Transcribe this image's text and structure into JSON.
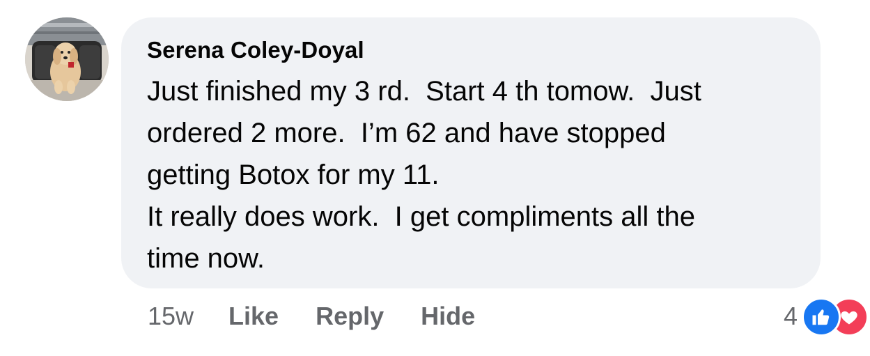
{
  "comment": {
    "author": "Serena Coley-Doyal",
    "body_lines": [
      "Just finished my 3 rd.  Start 4 th tomow.  Just",
      "ordered 2 more.  I’m 62 and have stopped",
      "getting Botox for my 11.",
      "It really does work.  I get compliments all the",
      "time now."
    ],
    "timestamp": "15w",
    "actions": {
      "like": "Like",
      "reply": "Reply",
      "hide": "Hide"
    },
    "reactions": {
      "count": "4",
      "types": [
        "like-icon",
        "love-icon"
      ],
      "colors": {
        "like": "#1877f2",
        "love": "#f33e58"
      }
    }
  },
  "colors": {
    "bubble": "#f0f2f5",
    "text": "#050505",
    "secondary_text": "#65676b"
  }
}
